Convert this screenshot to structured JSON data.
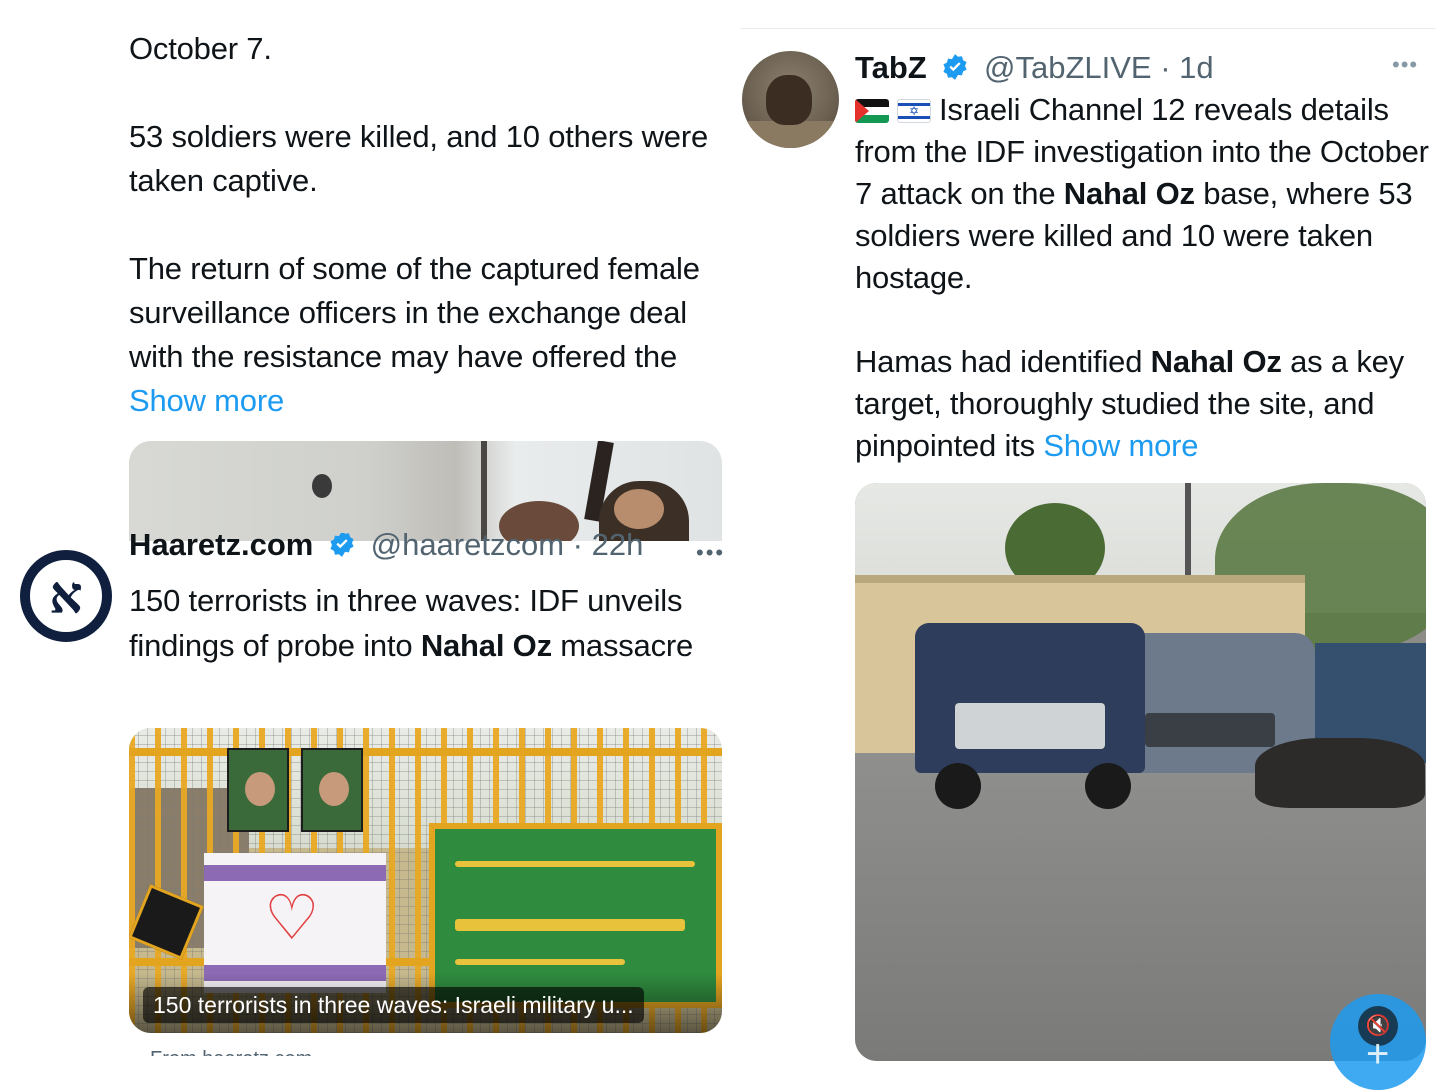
{
  "left_tweet": {
    "paragraphs": [
      "October 7.",
      "53 soldiers were killed, and 10 others were taken captive.",
      "The return of some of the captured female surveillance officers in the exchange deal with the resistance may have offered the"
    ],
    "show_more": "Show more"
  },
  "haaretz_tweet": {
    "name": "Haaretz.com",
    "handle": "@haaretzcom · 22h",
    "avatar_letter": "א",
    "text_before": "150 terrorists in three waves: IDF unveils findings of probe into ",
    "text_bold": "Nahal Oz",
    "text_after": " massacre",
    "card_caption": "150 terrorists in three waves: Israeli military u...",
    "from_label": "From haaretz.com"
  },
  "tabz_tweet": {
    "name": "TabZ",
    "handle": "@TabZLIVE · 1d",
    "text_part1": "Israeli Channel 12 reveals details from the IDF investigation into the October 7 attack on the ",
    "text_bold1": "Nahal Oz",
    "text_part2": " base, where 53 soldiers were killed and 10 were taken hostage.",
    "text_part3": "Hamas had identified ",
    "text_bold2": "Nahal Oz",
    "text_part4": " as a key target, thoroughly studied the site, and pinpointed its",
    "show_more": "Show more"
  },
  "icons": {
    "verified": "verified-badge-icon",
    "more": "more-options-icon",
    "mute": "speaker-muted-icon"
  },
  "colors": {
    "link": "#1d9bf0",
    "secondary_text": "#536471",
    "primary_text": "#0f1419",
    "verified": "#1d9bf0"
  }
}
